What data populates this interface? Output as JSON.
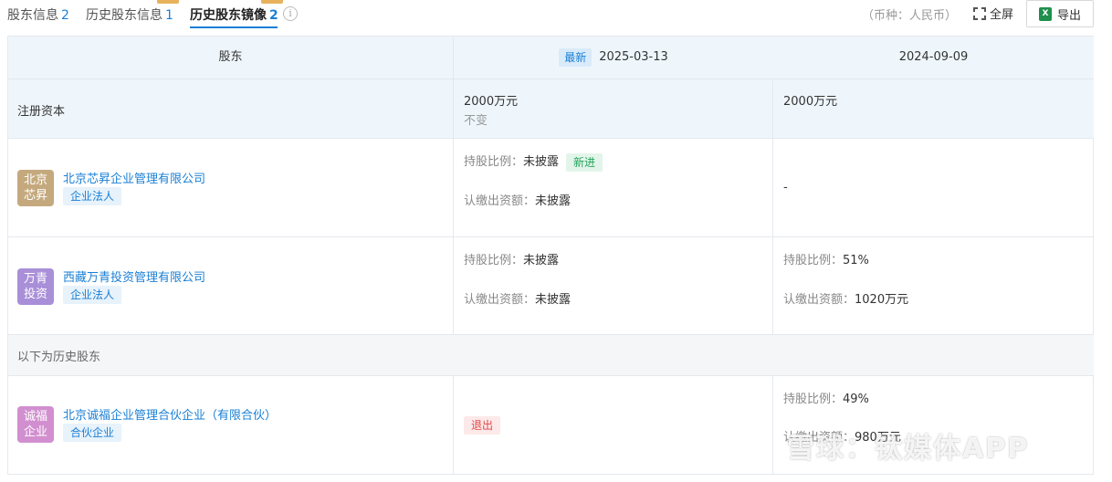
{
  "tabs": [
    {
      "label": "股东信息",
      "count": "2"
    },
    {
      "label": "历史股东信息",
      "count": "1"
    },
    {
      "label": "历史股东镜像",
      "count": "2"
    }
  ],
  "toolbar": {
    "currency": "（币种：人民币）",
    "fullscreen_label": "全屏",
    "export_label": "导出",
    "excel_icon_text": "X"
  },
  "header": {
    "shareholder_col": "股东",
    "latest_badge": "最新",
    "date_latest": "2025-03-13",
    "date_prev": "2024-09-09"
  },
  "registered_capital": {
    "label": "注册资本",
    "latest_value": "2000万元",
    "latest_change": "不变",
    "prev_value": "2000万元"
  },
  "shareholders": [
    {
      "logo_text": "北京\n芯昇",
      "logo_color": "#c5a97e",
      "name": "北京芯昇企业管理有限公司",
      "type": "企业法人",
      "latest": {
        "ratio_label": "持股比例：",
        "ratio_value": "未披露",
        "tag": "新进",
        "capital_label": "认缴出资额：",
        "capital_value": "未披露"
      },
      "prev": {
        "empty": "-"
      }
    },
    {
      "logo_text": "万青\n投资",
      "logo_color": "#a98fd8",
      "name": "西藏万青投资管理有限公司",
      "type": "企业法人",
      "latest": {
        "ratio_label": "持股比例：",
        "ratio_value": "未披露",
        "capital_label": "认缴出资额：",
        "capital_value": "未披露"
      },
      "prev": {
        "ratio_label": "持股比例：",
        "ratio_value": "51%",
        "capital_label": "认缴出资额：",
        "capital_value": "1020万元"
      }
    }
  ],
  "history_section_label": "以下为历史股东",
  "history_shareholders": [
    {
      "logo_text": "诚福\n企业",
      "logo_color": "#d18fcf",
      "name": "北京诚福企业管理合伙企业（有限合伙）",
      "type": "合伙企业",
      "latest": {
        "tag": "退出"
      },
      "prev": {
        "ratio_label": "持股比例：",
        "ratio_value": "49%",
        "capital_label": "认缴出资额：",
        "capital_value": "980万元"
      }
    }
  ],
  "watermark": "雪球：钛媒体APP"
}
